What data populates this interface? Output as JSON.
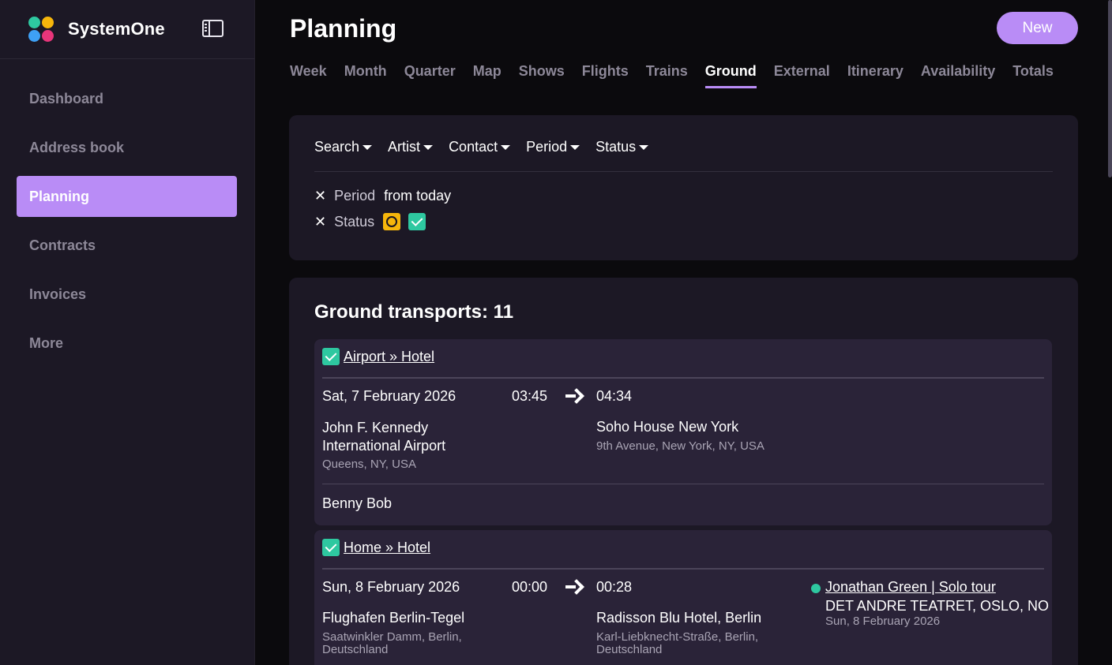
{
  "brand": {
    "name": "SystemOne",
    "logo_colors": [
      "#2ec8a0",
      "#f6b60b",
      "#b98cf6",
      "#3ea0f5",
      "#e8357a",
      "#7a5cf6"
    ]
  },
  "sidebar": {
    "items": [
      {
        "label": "Dashboard",
        "active": false
      },
      {
        "label": "Address book",
        "active": false
      },
      {
        "label": "Planning",
        "active": true
      },
      {
        "label": "Contracts",
        "active": false
      },
      {
        "label": "Invoices",
        "active": false
      },
      {
        "label": "More",
        "active": false
      }
    ]
  },
  "header": {
    "title": "Planning",
    "new_label": "New"
  },
  "tabs": [
    {
      "label": "Week"
    },
    {
      "label": "Month"
    },
    {
      "label": "Quarter"
    },
    {
      "label": "Map"
    },
    {
      "label": "Shows"
    },
    {
      "label": "Flights"
    },
    {
      "label": "Trains"
    },
    {
      "label": "Ground",
      "active": true
    },
    {
      "label": "External"
    },
    {
      "label": "Itinerary"
    },
    {
      "label": "Availability"
    },
    {
      "label": "Totals"
    }
  ],
  "filters": {
    "menus": [
      "Search",
      "Artist",
      "Contact",
      "Period",
      "Status"
    ],
    "active": {
      "period_label": "Period",
      "period_value": "from today",
      "status_label": "Status"
    }
  },
  "list": {
    "title": "Ground transports: 11",
    "transports": [
      {
        "route": "Airport » Hotel",
        "date": "Sat, 7 February 2026",
        "depart": "03:45",
        "arrive": "04:34",
        "from_name": "John F. Kennedy International Airport",
        "from_addr": "Queens, NY, USA",
        "to_name": "Soho House New York",
        "to_addr": "9th Avenue, New York, NY, USA",
        "passenger": "Benny Bob"
      },
      {
        "route": "Home » Hotel",
        "date": "Sun, 8 February 2026",
        "depart": "00:00",
        "arrive": "00:28",
        "from_name": "Flughafen Berlin-Tegel",
        "from_addr": "Saatwinkler Damm, Berlin, Deutschland",
        "to_name": "Radisson Blu Hotel, Berlin",
        "to_addr": "Karl-Liebknecht-Straße, Berlin, Deutschland",
        "event_link": "Jonathan Green | Solo tour",
        "event_venue": "DET ANDRE TEATRET, OSLO, NO",
        "event_date": "Sun, 8 February 2026"
      }
    ]
  }
}
